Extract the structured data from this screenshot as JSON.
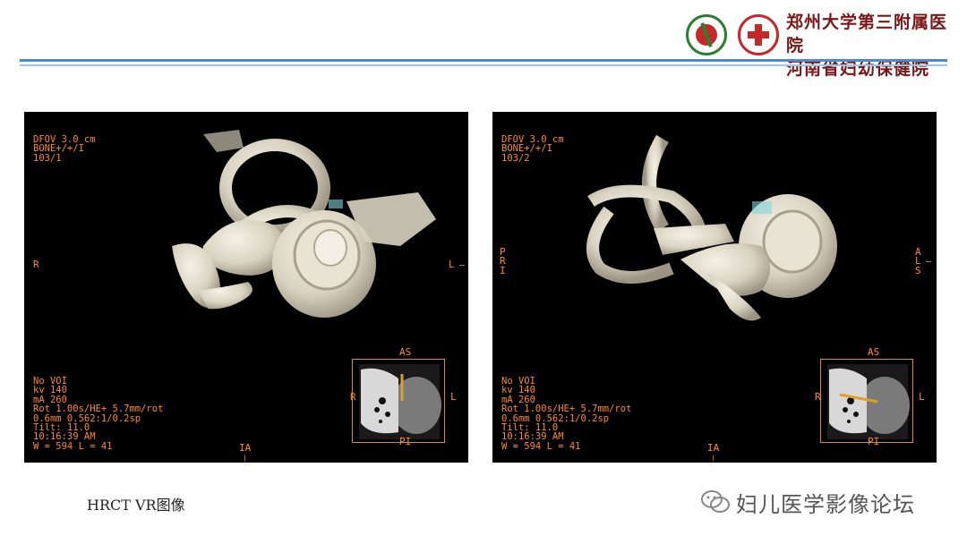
{
  "header": {
    "hospital_name_line1": "郑州大学第三附属医院",
    "hospital_name_line2": "河南省妇幼保健院"
  },
  "scans": [
    {
      "top_overlay": "DFOV 3.0 cm\nBONE+/+/I\n103/1",
      "bottom_overlay": "No VOI\nkv 140\nmA 260\nRot 1.00s/HE+ 5.7mm/rot\n0.6mm 0.562:1/0.2sp\nTilt: 11.0\n10:16:39 AM\nW = 594 L = 41",
      "left_marker": "R",
      "right_marker": "L",
      "bottom_marker": "IA",
      "inset": {
        "top": "AS",
        "bottom": "PI",
        "left": "R",
        "right": "L"
      }
    },
    {
      "top_overlay": "DFOV 3.0 cm\nBONE+/+/I\n103/2",
      "bottom_overlay": "No VOI\nkv 140\nmA 260\nRot 1.00s/HE+ 5.7mm/rot\n0.6mm 0.562:1/0.2sp\nTilt: 11.0\n10:16:39 AM\nW = 594 L = 41",
      "left_marker": "P\nR\nI",
      "right_marker": "A\nL\nS",
      "bottom_marker": "IA",
      "inset": {
        "top": "AS",
        "bottom": "PI",
        "left": "R",
        "right": "L"
      }
    }
  ],
  "caption": "HRCT VR图像",
  "watermark": "妇儿医学影像论坛",
  "colors": {
    "overlay_text": "#ff8a1e",
    "header_line": "#4a8cc7",
    "hospital_name": "#7b1616"
  }
}
